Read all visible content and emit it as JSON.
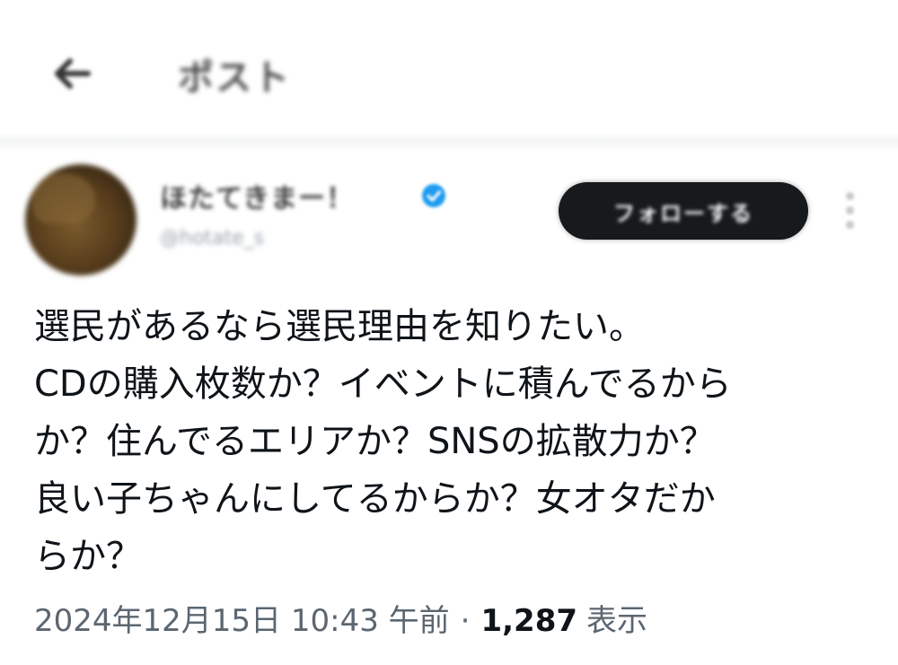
{
  "header": {
    "back_icon": "arrow-left-icon",
    "title": "ポスト"
  },
  "author": {
    "display_name": "ほたてきまー！",
    "handle": "@hotate_s",
    "verified": true,
    "verified_color": "#1d9bf0",
    "follow_label": "フォローする",
    "more_icon": "more-vertical-icon"
  },
  "tweet": {
    "lines": [
      "選民があるなら選民理由を知りたい。",
      "CDの購入枚数か？イベントに積んでるから",
      "か？住んでるエリアか？SNSの拡散力か？",
      "良い子ちゃんにしてるからか？女オタだか",
      "らか？"
    ]
  },
  "meta": {
    "timestamp": "2024年12月15日 10:43 午前",
    "separator": "·",
    "view_count": "1,287",
    "view_label": "表示"
  },
  "colors": {
    "text": "#0f1419",
    "muted": "#5b6670",
    "follow_button_bg": "#161a1d"
  }
}
